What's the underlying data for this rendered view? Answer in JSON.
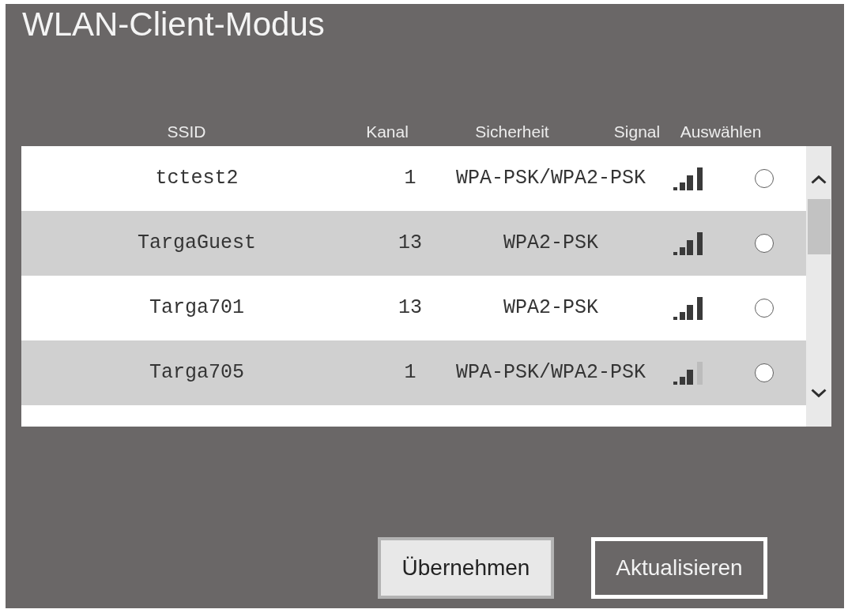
{
  "window": {
    "title": "WLAN-Client-Modus"
  },
  "table": {
    "columns": [
      "SSID",
      "Kanal",
      "Sicherheit",
      "Signal",
      "Auswählen"
    ],
    "rows": [
      {
        "ssid": "tctest2",
        "channel": "1",
        "security": "WPA-PSK/WPA2-PSK",
        "weak_signal": false,
        "selected": false
      },
      {
        "ssid": "TargaGuest",
        "channel": "13",
        "security": "WPA2-PSK",
        "weak_signal": false,
        "selected": false
      },
      {
        "ssid": "Targa701",
        "channel": "13",
        "security": "WPA2-PSK",
        "weak_signal": false,
        "selected": false
      },
      {
        "ssid": "Targa705",
        "channel": "1",
        "security": "WPA-PSK/WPA2-PSK",
        "weak_signal": true,
        "selected": false
      }
    ]
  },
  "buttons": [
    {
      "label": "Übernehmen",
      "kind": "filled"
    },
    {
      "label": "Aktualisieren",
      "kind": "outlined"
    }
  ]
}
